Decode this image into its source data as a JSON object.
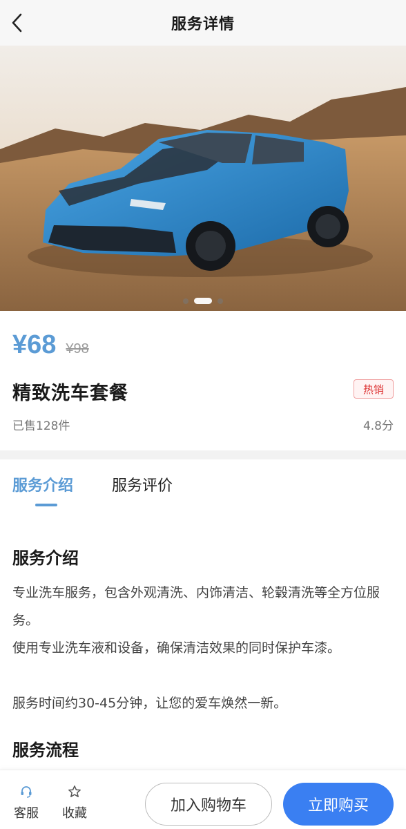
{
  "header": {
    "title": "服务详情",
    "back_icon": "chevron-left-icon"
  },
  "carousel": {
    "slide_count": 3,
    "active_index": 1
  },
  "product": {
    "price": "¥68",
    "original_price": "¥98",
    "name": "精致洗车套餐",
    "badge": "热销",
    "sold": "已售128件",
    "rating": "4.8分"
  },
  "tabs": [
    {
      "label": "服务介绍",
      "active": true
    },
    {
      "label": "服务评价",
      "active": false
    }
  ],
  "intro": {
    "title": "服务介绍",
    "paragraphs": [
      "专业洗车服务，包含外观清洗、内饰清洁、轮毂清洗等全方位服务。",
      "使用专业洗车液和设备，确保清洁效果的同时保护车漆。",
      "服务时间约30-45分钟，让您的爱车焕然一新。"
    ]
  },
  "process": {
    "title": "服务流程"
  },
  "bottom_bar": {
    "service": {
      "label": "客服",
      "icon": "headset-icon"
    },
    "favorite": {
      "label": "收藏",
      "icon": "star-icon"
    },
    "add_to_cart": "加入购物车",
    "buy_now": "立即购买"
  },
  "colors": {
    "accent": "#5b9bd5",
    "buy_button": "#3a7ff2",
    "badge_text": "#dd3333"
  }
}
